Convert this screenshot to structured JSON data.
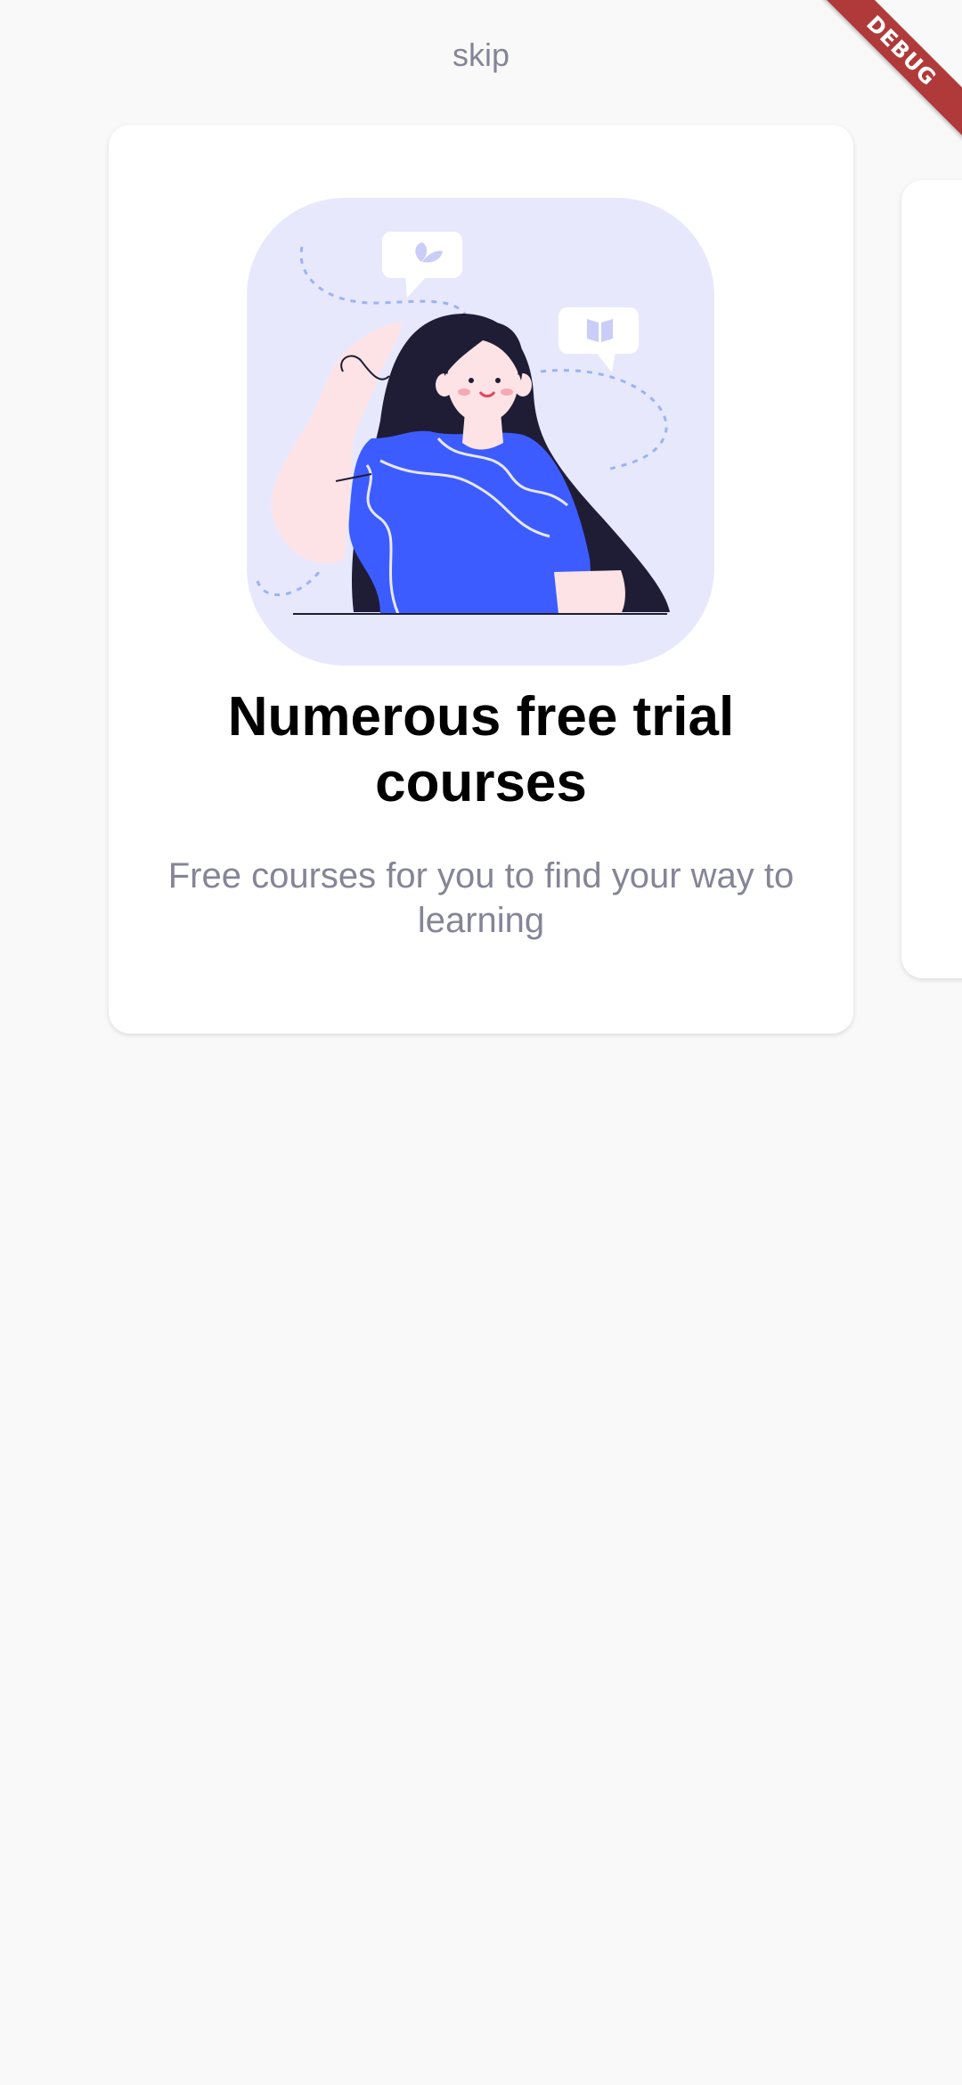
{
  "skip_label": "skip",
  "debug_label": "DEBUG",
  "onboarding": {
    "title": "Numerous free trial courses",
    "subtitle": "Free courses for you to find your way to learning"
  },
  "colors": {
    "background": "#f9f9f9",
    "card": "#ffffff",
    "illustration_bg": "#e8e8fd",
    "shirt": "#3d5cff",
    "text_muted": "#858597",
    "debug": "#b03a3a"
  }
}
